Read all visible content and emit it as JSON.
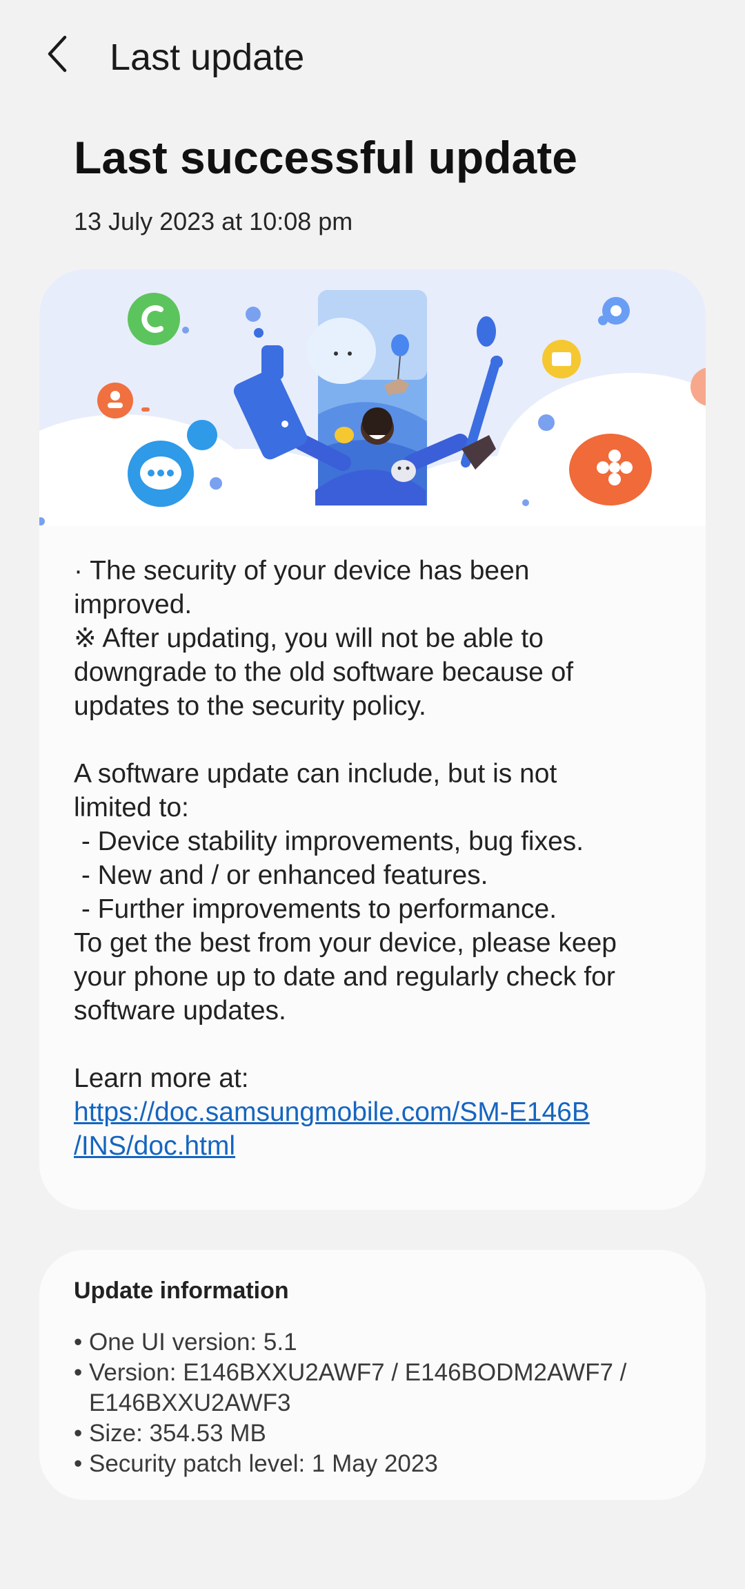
{
  "appbar": {
    "title": "Last update",
    "back_icon": "chevron-left-icon"
  },
  "page": {
    "heading": "Last successful update",
    "date": "13 July 2023 at 10:08 pm"
  },
  "notes": {
    "lines_1": [
      "· The security of your device has been",
      "improved.",
      "※ After updating, you will not be able to",
      "downgrade to the old software because of",
      "updates to the security policy."
    ],
    "lines_2": [
      "A software update can include, but is not",
      "limited to:",
      " - Device stability improvements, bug fixes.",
      " - New and / or enhanced features.",
      " - Further improvements to performance.",
      "To get the best from your device, please keep",
      "your phone up to date and regularly check for",
      "software updates."
    ],
    "learn_more": "Learn more at:",
    "link_line_1": "https://doc.samsungmobile.com/SM-E146B",
    "link_line_2": "/INS/doc.html"
  },
  "update_info": {
    "title": "Update information",
    "items": [
      "One UI version: 5.1",
      "Version: E146BXXU2AWF7 / E146BODM2AWF7 / E146BXXU2AWF3",
      "Size: 354.53 MB",
      "Security patch level: 1 May 2023"
    ]
  },
  "colors": {
    "background": "#f2f2f2",
    "card": "#fbfbfb",
    "link": "#1565c0",
    "illustration_sky": "#e8edfb"
  }
}
